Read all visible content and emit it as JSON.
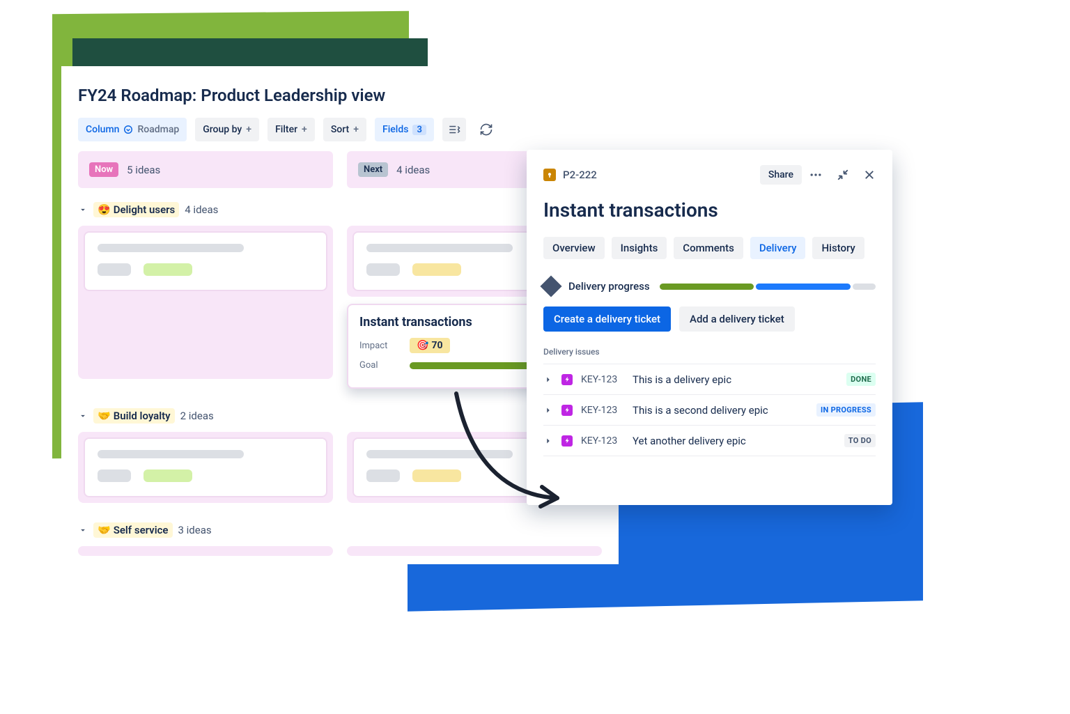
{
  "board": {
    "title": "FY24 Roadmap: Product Leadership view",
    "toolbar": {
      "column_label": "Column",
      "column_value": "Roadmap",
      "group_by": "Group by",
      "filter": "Filter",
      "sort": "Sort",
      "fields": "Fields",
      "fields_count": "3"
    },
    "columns": [
      {
        "tag": "Now",
        "count": "5 ideas"
      },
      {
        "tag": "Next",
        "count": "4 ideas"
      }
    ],
    "groups": [
      {
        "emoji": "😍",
        "name": "Delight users",
        "count": "4 ideas"
      },
      {
        "emoji": "🤝",
        "name": "Build loyalty",
        "count": "2 ideas"
      },
      {
        "emoji": "🤝",
        "name": "Self service",
        "count": "3 ideas"
      }
    ],
    "highlight_card": {
      "title": "Instant transactions",
      "impact_label": "Impact",
      "impact_value": "70",
      "goal_label": "Goal"
    }
  },
  "panel": {
    "issue_key": "P2-222",
    "share": "Share",
    "title": "Instant transactions",
    "tabs": [
      "Overview",
      "Insights",
      "Comments",
      "Delivery",
      "History"
    ],
    "active_tab": "Delivery",
    "progress_label": "Delivery progress",
    "btn_create": "Create a delivery ticket",
    "btn_add": "Add a delivery ticket",
    "issues_label": "Delivery issues",
    "issues": [
      {
        "key": "KEY-123",
        "title": "This is a delivery epic",
        "status": "DONE",
        "status_class": "st-done"
      },
      {
        "key": "KEY-123",
        "title": "This is a second delivery epic",
        "status": "IN PROGRESS",
        "status_class": "st-prog"
      },
      {
        "key": "KEY-123",
        "title": "Yet another delivery epic",
        "status": "TO DO",
        "status_class": "st-todo"
      }
    ]
  }
}
